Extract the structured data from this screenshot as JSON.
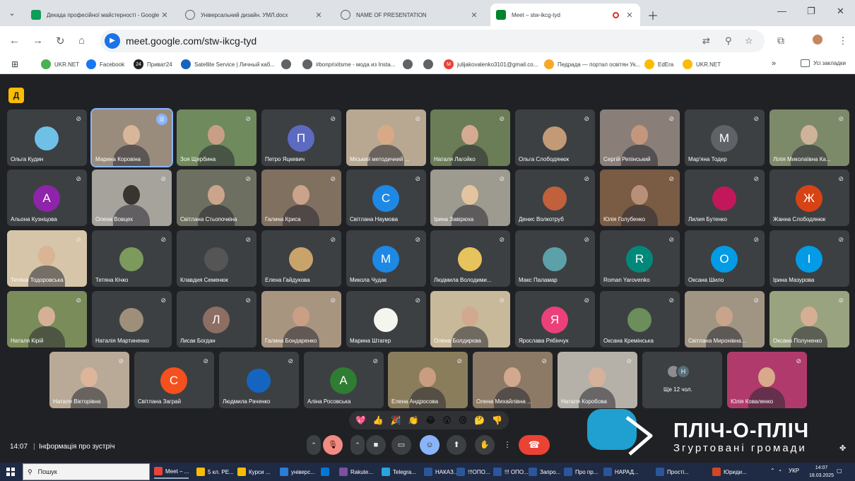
{
  "browser": {
    "tabs": [
      {
        "title": "Декада професійної майстерності - Google Т",
        "icon": "sheets-icon",
        "color": "#0f9d58"
      },
      {
        "title": "Універсальний дизайн. УМЛ.docx",
        "icon": "globe-icon",
        "color": "#5f6368"
      },
      {
        "title": "NAME OF PRESENTATION",
        "icon": "globe-icon",
        "color": "#5f6368"
      },
      {
        "title": "Meet – stw-ikcg-tyd",
        "icon": "meet-icon",
        "color": "#00832d",
        "active": true,
        "recording": true
      }
    ],
    "url": "meet.google.com/stw-ikcg-tyd",
    "bookmarks": [
      {
        "label": "UKR.NET",
        "color": "#4caf50"
      },
      {
        "label": "Facebook",
        "color": "#1877f2"
      },
      {
        "label": "Приват24",
        "color": "#222222",
        "badge": "24"
      },
      {
        "label": "Satellite Service | Личный каб...",
        "color": "#1565c0"
      },
      {
        "label": "",
        "color": "#5f6368"
      },
      {
        "label": "#bonprixitsme - мода из Insta...",
        "color": "#5f6368"
      },
      {
        "label": "",
        "color": "#5f6368"
      },
      {
        "label": "",
        "color": "#5f6368"
      },
      {
        "label": "julijakovalenko3101@gmail.co...",
        "color": "#ea4335",
        "badge": "M"
      },
      {
        "label": "Педрада — портал освітян Ук...",
        "color": "#f9a825"
      },
      {
        "label": "EdEra",
        "color": "#fbbc04"
      },
      {
        "label": "UKR.NET",
        "color": "#fbbc04"
      }
    ],
    "bookmarks_folder": "Усі закладки"
  },
  "meet": {
    "badge": "Д",
    "participants": [
      {
        "name": "Ольга Кудин",
        "kind": "pic",
        "color": "#6fc0e6"
      },
      {
        "name": "Марина Коровіна",
        "kind": "video",
        "color": "#9a8c7c",
        "skin": "#d9b59a",
        "speaking": true
      },
      {
        "name": "Зоя Щербина",
        "kind": "video",
        "color": "#6f8a5c",
        "skin": "#c99e86"
      },
      {
        "name": "Петро Яцкевич",
        "kind": "initial",
        "initial": "П",
        "color": "#5c6bc0"
      },
      {
        "name": "Міський методичний ...",
        "kind": "video",
        "color": "#b8a892",
        "skin": "#d9a887"
      },
      {
        "name": "Наталя Лагойко",
        "kind": "video",
        "color": "#6b7d56",
        "skin": "#d4ab92"
      },
      {
        "name": "Ольга Слободянюк",
        "kind": "pic",
        "color": "#c29a76"
      },
      {
        "name": "Сергій Репінський",
        "kind": "video",
        "color": "#8a7f78",
        "skin": "#c4977c"
      },
      {
        "name": "Мар'яна Тодер",
        "kind": "initial",
        "initial": "М",
        "color": "#5f6368"
      },
      {
        "name": "Лілія Миколаївна Ка...",
        "kind": "video",
        "color": "#7d8a6a",
        "skin": "#cfb29a"
      },
      {
        "name": "Альона Кузніцова",
        "kind": "initial",
        "initial": "А",
        "color": "#8e24aa"
      },
      {
        "name": "Олена Вовцех",
        "kind": "video",
        "color": "#a6a39d",
        "skin": "#3a3430"
      },
      {
        "name": "Світлана Стьопочкіна",
        "kind": "video",
        "color": "#6d7060",
        "skin": "#caa58c"
      },
      {
        "name": "Галина Криса",
        "kind": "video",
        "color": "#807060",
        "skin": "#c9a38a"
      },
      {
        "name": "Світлана Наумова",
        "kind": "initial",
        "initial": "С",
        "color": "#1e88e5"
      },
      {
        "name": "Ірина Завірюха",
        "kind": "video",
        "color": "#9d9a8f",
        "skin": "#e3c49e"
      },
      {
        "name": "Денис Волкотруб",
        "kind": "pic",
        "color": "#c0613b"
      },
      {
        "name": "Юлія Голубенко",
        "kind": "video",
        "color": "#7a5b43",
        "skin": "#b8907a"
      },
      {
        "name": "Лилия Бутенко",
        "kind": "pic",
        "color": "#c2185b"
      },
      {
        "name": "Жанна Слободянюк",
        "kind": "initial",
        "initial": "Ж",
        "color": "#d84315"
      },
      {
        "name": "Тетяна Тодоровська",
        "kind": "video",
        "color": "#d6c5a8",
        "skin": "#d9b495"
      },
      {
        "name": "Тетяна Кічко",
        "kind": "pic",
        "color": "#7c9a5c"
      },
      {
        "name": "Клавдия Семенюк",
        "kind": "pic",
        "color": "#555555"
      },
      {
        "name": "Елена Гайдукова",
        "kind": "pic",
        "color": "#c9a46a"
      },
      {
        "name": "Микола Чудак",
        "kind": "initial",
        "initial": "М",
        "color": "#1e88e5"
      },
      {
        "name": "Людмила Володими...",
        "kind": "pic",
        "color": "#e6c35c"
      },
      {
        "name": "Макс Паламар",
        "kind": "pic",
        "color": "#5ca0a8"
      },
      {
        "name": "Roman Yarovenko",
        "kind": "initial",
        "initial": "R",
        "color": "#00897b"
      },
      {
        "name": "Оксана Шило",
        "kind": "initial",
        "initial": "О",
        "color": "#039be5"
      },
      {
        "name": "Ірина Мазурова",
        "kind": "initial",
        "initial": "І",
        "color": "#039be5"
      },
      {
        "name": "Наталя Кірій",
        "kind": "video",
        "color": "#7a8c5a",
        "skin": "#d6b096"
      },
      {
        "name": "Наталія Мартиненко",
        "kind": "pic",
        "color": "#9e8f7a"
      },
      {
        "name": "Лисак Богдан",
        "kind": "initial",
        "initial": "Л",
        "color": "#8d6e63"
      },
      {
        "name": "Галина Бондаренко",
        "kind": "video",
        "color": "#a89580",
        "skin": "#c99f86"
      },
      {
        "name": "Марина Штагер",
        "kind": "pic",
        "color": "#f5f5f0"
      },
      {
        "name": "Олена Болдирєва",
        "kind": "video",
        "color": "#c8b99a",
        "skin": "#d1a98f"
      },
      {
        "name": "Ярослава Рябінчук",
        "kind": "initial",
        "initial": "Я",
        "color": "#ec407a"
      },
      {
        "name": "Оксана Кремінська",
        "kind": "pic",
        "color": "#6b8e5a"
      },
      {
        "name": "Світлана Миронівна...",
        "kind": "video",
        "color": "#a09582",
        "skin": "#c9a48c"
      },
      {
        "name": "Оксана Полуненко",
        "kind": "video",
        "color": "#9aa37f",
        "skin": "#d6ae93"
      },
      {
        "name": "Наталя Вікторівна",
        "kind": "video",
        "color": "#b9aa98",
        "skin": "#dcb59b"
      },
      {
        "name": "Світлана Заграй",
        "kind": "initial",
        "initial": "С",
        "color": "#f4511e"
      },
      {
        "name": "Людмила Раченко",
        "kind": "pic",
        "color": "#1565c0"
      },
      {
        "name": "Аліна Росовська",
        "kind": "initial",
        "initial": "А",
        "color": "#2e7d32"
      },
      {
        "name": "Елена Андросова",
        "kind": "video",
        "color": "#8a7d5c",
        "skin": "#c99d80"
      },
      {
        "name": "Олена Михайлівна ...",
        "kind": "video",
        "color": "#8c7a66",
        "skin": "#d2a98e"
      },
      {
        "name": "Наталя Коробова",
        "kind": "video",
        "color": "#b5b1a8",
        "skin": "#d6b29a"
      },
      {
        "name": "Ще 12 чол.",
        "kind": "more",
        "color": "#3c4043"
      },
      {
        "name": "Юлія Коваленко",
        "kind": "video",
        "color": "#b03a6c",
        "skin": "#d9a98c"
      }
    ],
    "reactions": [
      "💖",
      "👍",
      "🎉",
      "👏",
      "😂",
      "😮",
      "😢",
      "🤔",
      "👎"
    ],
    "time": "14:07",
    "info_label": "Інформація про зустріч"
  },
  "overlay": {
    "title": "ПЛІЧ-О-ПЛІЧ",
    "subtitle": "Згуртовані громади",
    "color": "#1fa0d0"
  },
  "taskbar": {
    "search_placeholder": "Пошук",
    "apps": [
      {
        "label": "Meet – ...",
        "color": "#ea4335"
      },
      {
        "label": "5 кл. РЕ...",
        "color": "#fbbc04"
      },
      {
        "label": "Курси ...",
        "color": "#fbbc04"
      },
      {
        "label": "універс...",
        "color": "#2b7cd3"
      },
      {
        "label": "",
        "color": "#0078d4"
      },
      {
        "label": "Rakute...",
        "color": "#7b519d"
      },
      {
        "label": "Telegra...",
        "color": "#2aa3df"
      },
      {
        "label": "НАКАЗ...",
        "color": "#2b579a"
      },
      {
        "label": "!!!ОПО...",
        "color": "#2b579a"
      },
      {
        "label": "!!! ОПО...",
        "color": "#2b579a"
      },
      {
        "label": "Запро...",
        "color": "#2b579a"
      },
      {
        "label": "Про пр...",
        "color": "#2b579a"
      },
      {
        "label": "НАРАД...",
        "color": "#2b579a"
      },
      {
        "label": "Прості...",
        "color": "#2b579a"
      },
      {
        "label": "Юриди...",
        "color": "#d24726"
      }
    ],
    "lang": "УКР",
    "time": "14:07",
    "date": "18.03.2025"
  }
}
